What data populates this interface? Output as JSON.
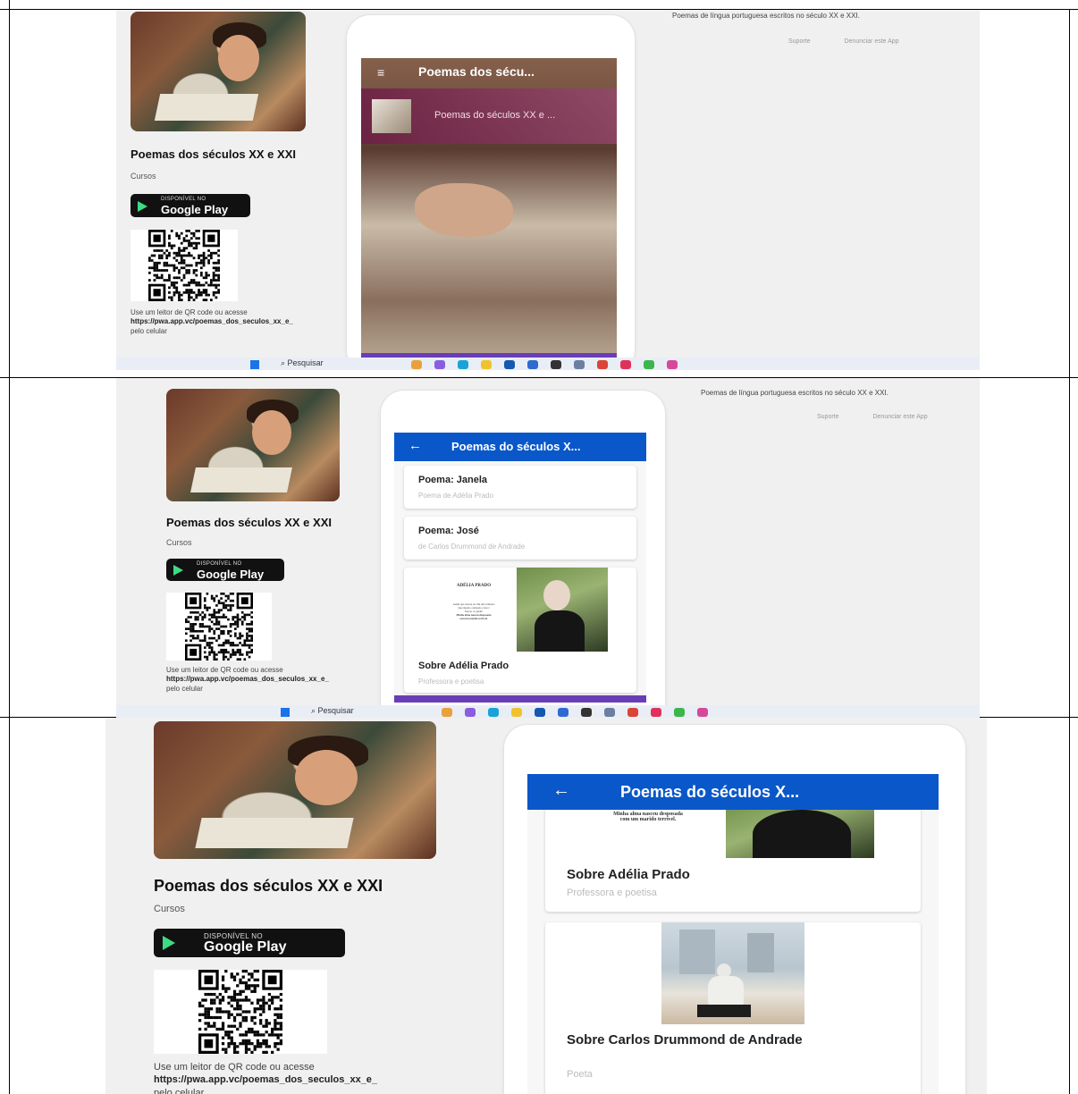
{
  "app": {
    "title": "Poemas dos séculos XX e XXI",
    "category": "Cursos",
    "description": "Poemas de língua portuguesa escritos no século XX e XXI.",
    "support_link": "Suporte",
    "report_link": "Denunciar este App",
    "google_play_small": "DISPONÍVEL NO",
    "google_play_big": "Google Play",
    "qr_hint": "Use um leitor de QR code ou acesse",
    "qr_url": "https://pwa.app.vc/poemas_dos_seculos_xx_e_",
    "qr_device": "pelo celular"
  },
  "screen1": {
    "appbar_title": "Poemas dos sécu...",
    "banner_text": "Poemas do séculos XX e ..."
  },
  "screen2": {
    "appbar_title": "Poemas do séculos X...",
    "cards": [
      {
        "title": "Poema: Janela",
        "subtitle": "Poema de Adélia Prado"
      },
      {
        "title": "Poema: José",
        "subtitle": "de Carlos Drummond de Andrade"
      },
      {
        "title": "Sobre Adélia Prado",
        "subtitle": "Professora e poetisa"
      }
    ],
    "poem_heading": "ADÉLIA PRADO",
    "poem_lines": [
      "Assim que nasceu eu vim um tormento",
      "Que mundo ordenado e feno!",
      "Nascer os quem!",
      "Minha alma nasceu desposada",
      "com um marido terrível."
    ]
  },
  "screen3": {
    "appbar_title": "Poemas do séculos X...",
    "poem_tail": [
      "Minha alma nasceu desposada",
      "com um marido terrível."
    ],
    "cards": [
      {
        "title": "Sobre Adélia Prado",
        "subtitle": "Professora e poetisa"
      },
      {
        "title": "Sobre Carlos Drummond de Andrade",
        "subtitle": "Poeta"
      }
    ]
  },
  "taskbar": {
    "search_label": "Pesquisar"
  },
  "colors": {
    "appbar_blue": "#0a57c9",
    "accent_purple": "#6a3db8",
    "page_bg": "#f0f0f0"
  },
  "icons": [
    "menu-icon",
    "back-arrow-icon",
    "windows-start-icon",
    "search-icon",
    "play-triangle-icon"
  ]
}
